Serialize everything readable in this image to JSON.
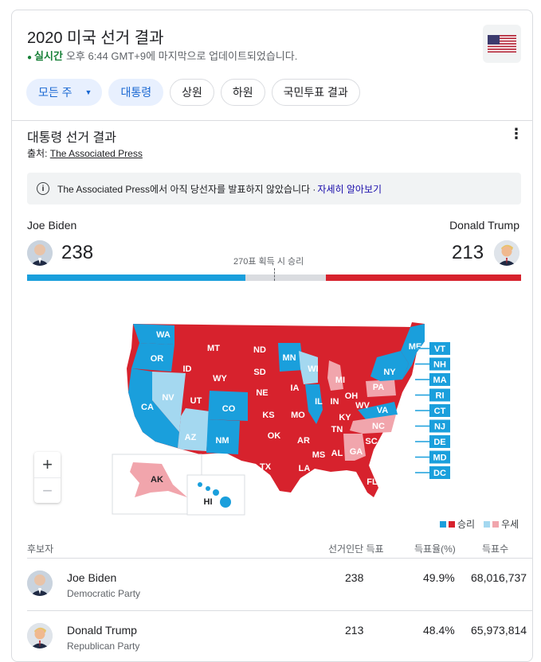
{
  "header": {
    "title": "2020 미국 선거 결과",
    "live_label": "실시간",
    "updated_text": "오후 6:44 GMT+9에 마지막으로 업데이트되었습니다."
  },
  "chips": [
    {
      "label": "모든 주",
      "selected": true,
      "dropdown": true
    },
    {
      "label": "대통령",
      "selected": true
    },
    {
      "label": "상원",
      "selected": false
    },
    {
      "label": "하원",
      "selected": false
    },
    {
      "label": "국민투표 결과",
      "selected": false
    }
  ],
  "section": {
    "title": "대통령 선거 결과",
    "source_label": "출처:",
    "source_name": "The Associated Press"
  },
  "notice": {
    "text": "The Associated Press에서 아직 당선자를 발표하지 않았습니다 · ",
    "link": "자세히 알아보기"
  },
  "candidates": {
    "biden": {
      "name": "Joe Biden",
      "votes": "238",
      "party": "Democratic Party",
      "popular_pct": "49.9%",
      "popular_votes": "68,016,737",
      "color": "#1a9fdc"
    },
    "trump": {
      "name": "Donald Trump",
      "votes": "213",
      "party": "Republican Party",
      "popular_pct": "48.4%",
      "popular_votes": "65,973,814",
      "color": "#d7222d"
    }
  },
  "threshold_text": "270표 획득 시 승리",
  "progress": {
    "total": 538,
    "biden": 238,
    "trump": 213
  },
  "map": {
    "states_won_dem": [
      "WA",
      "OR",
      "CA",
      "CO",
      "NM",
      "MN",
      "IL",
      "NY",
      "VA"
    ],
    "states_won_rep": [
      "MT",
      "ID",
      "WY",
      "UT",
      "ND",
      "SD",
      "NE",
      "KS",
      "OK",
      "TX",
      "IA",
      "MO",
      "AR",
      "LA",
      "MS",
      "AL",
      "TN",
      "KY",
      "IN",
      "OH",
      "WV",
      "SC",
      "FL"
    ],
    "states_lead_dem": [
      "NV",
      "AZ",
      "WI"
    ],
    "states_lead_rep": [
      "MI",
      "PA",
      "NC",
      "GA",
      "AK"
    ],
    "other_labels": [
      "ME",
      "HI"
    ],
    "small_states": [
      "VT",
      "NH",
      "MA",
      "RI",
      "CT",
      "NJ",
      "DE",
      "MD",
      "DC"
    ],
    "colors": {
      "won_dem": "#1a9fdc",
      "lead_dem": "#a4d8f0",
      "won_rep": "#d7222d",
      "lead_rep": "#f1a5ac"
    }
  },
  "legend": {
    "won": "승리",
    "leading": "우세"
  },
  "table": {
    "headers": {
      "candidate": "후보자",
      "electoral": "선거인단 득표",
      "pct": "득표율(%)",
      "votes": "득표수"
    }
  }
}
